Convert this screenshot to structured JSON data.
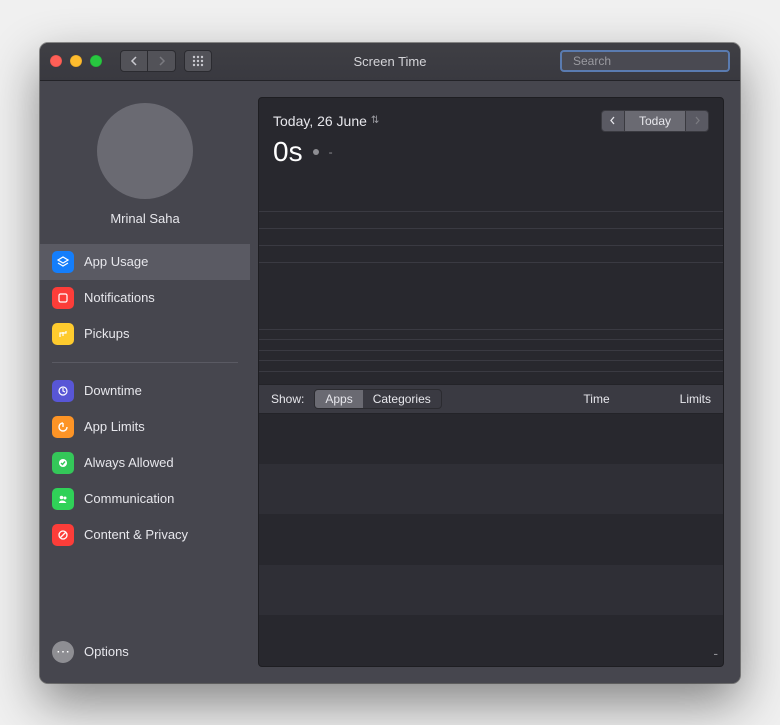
{
  "window": {
    "title": "Screen Time"
  },
  "search": {
    "placeholder": "Search",
    "value": ""
  },
  "user": {
    "name": "Mrinal  Saha"
  },
  "sidebar": {
    "items": [
      {
        "label": "App Usage",
        "icon": "app-usage-icon",
        "selected": true
      },
      {
        "label": "Notifications",
        "icon": "notifications-icon"
      },
      {
        "label": "Pickups",
        "icon": "pickups-icon"
      }
    ],
    "sections": [
      {
        "label": "Downtime",
        "icon": "downtime-icon"
      },
      {
        "label": "App Limits",
        "icon": "app-limits-icon"
      },
      {
        "label": "Always Allowed",
        "icon": "always-allowed-icon"
      },
      {
        "label": "Communication",
        "icon": "communication-icon"
      },
      {
        "label": "Content & Privacy",
        "icon": "content-privacy-icon"
      }
    ],
    "options_label": "Options"
  },
  "main": {
    "date_label": "Today, 26 June",
    "duration": "0s",
    "today_button": "Today",
    "show_label": "Show:",
    "toggle_apps": "Apps",
    "toggle_categories": "Categories",
    "column_time": "Time",
    "column_limits": "Limits"
  }
}
